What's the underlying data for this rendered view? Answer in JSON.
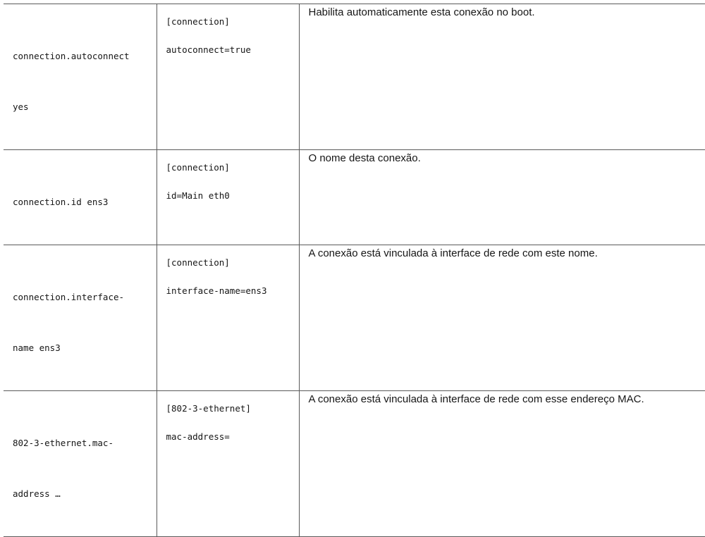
{
  "rows": [
    {
      "property": [
        "connection.autoconnect",
        "yes"
      ],
      "section": "[connection]",
      "keyvalue": "autoconnect=true",
      "description": "Habilita automaticamente esta conexão no boot."
    },
    {
      "property": [
        "connection.id ens3"
      ],
      "section": "[connection]",
      "keyvalue": "id=Main eth0",
      "description": "O nome desta conexão."
    },
    {
      "property": [
        "connection.interface-",
        "name ens3"
      ],
      "section": "[connection]",
      "keyvalue": "interface-name=ens3",
      "description": "A conexão está vinculada à interface de rede com este nome."
    },
    {
      "property": [
        "802-3-ethernet.mac-",
        "address …"
      ],
      "section": "[802-3-ethernet]",
      "keyvalue": "mac-address=",
      "description": "A conexão está vinculada à interface de rede com esse endereço MAC."
    }
  ]
}
